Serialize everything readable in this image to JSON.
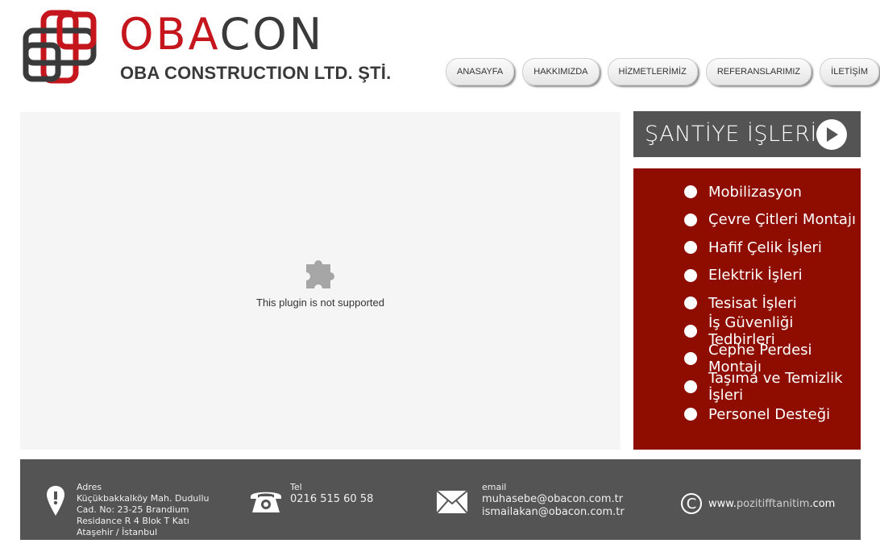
{
  "brand": {
    "name_red": "OB",
    "name_mid": "A",
    "name_rest": "CON",
    "subtitle": "OBA CONSTRUCTION LTD. ŞTİ.",
    "colors": {
      "red": "#c4161c",
      "gray": "#3a3a3a"
    }
  },
  "nav": [
    {
      "label": "ANASAYFA"
    },
    {
      "label": "HAKKIMIZDA"
    },
    {
      "label": "HİZMETLERİMİZ"
    },
    {
      "label": "REFERANSLARIMIZ"
    },
    {
      "label": "İLETİŞİM"
    }
  ],
  "plugin": {
    "message": "This plugin is not supported",
    "icon": "puzzle-icon"
  },
  "side": {
    "title": "ŞANTİYE İŞLERİ",
    "header_color": "#545454",
    "list_color": "#8e0d00",
    "items": [
      "Mobilizasyon",
      "Çevre Çitleri Montajı",
      "Hafif Çelik İşleri",
      "Elektrik İşleri",
      "Tesisat İşleri",
      "İş Güvenliği Tedbirleri",
      "Cephe Perdesi Montajı",
      "Taşıma ve Temizlik İşleri",
      "Personel Desteği"
    ]
  },
  "footer": {
    "address": {
      "label": "Adres",
      "lines": [
        "Küçükbakkalköy Mah. Dudullu",
        "Cad. No: 23-25 Brandium",
        "Residance R 4 Blok T Katı",
        "Ataşehir / İstanbul"
      ]
    },
    "tel": {
      "label": "Tel",
      "value": "0216 515 60 58"
    },
    "email": {
      "label": "email",
      "values": [
        "muhasebe@obacon.com.tr",
        "ismailakan@obacon.com.tr"
      ]
    },
    "credit": {
      "prefix": "www.",
      "name": "pozitifftanitim",
      "suffix": ".com",
      "symbol": "C"
    }
  }
}
